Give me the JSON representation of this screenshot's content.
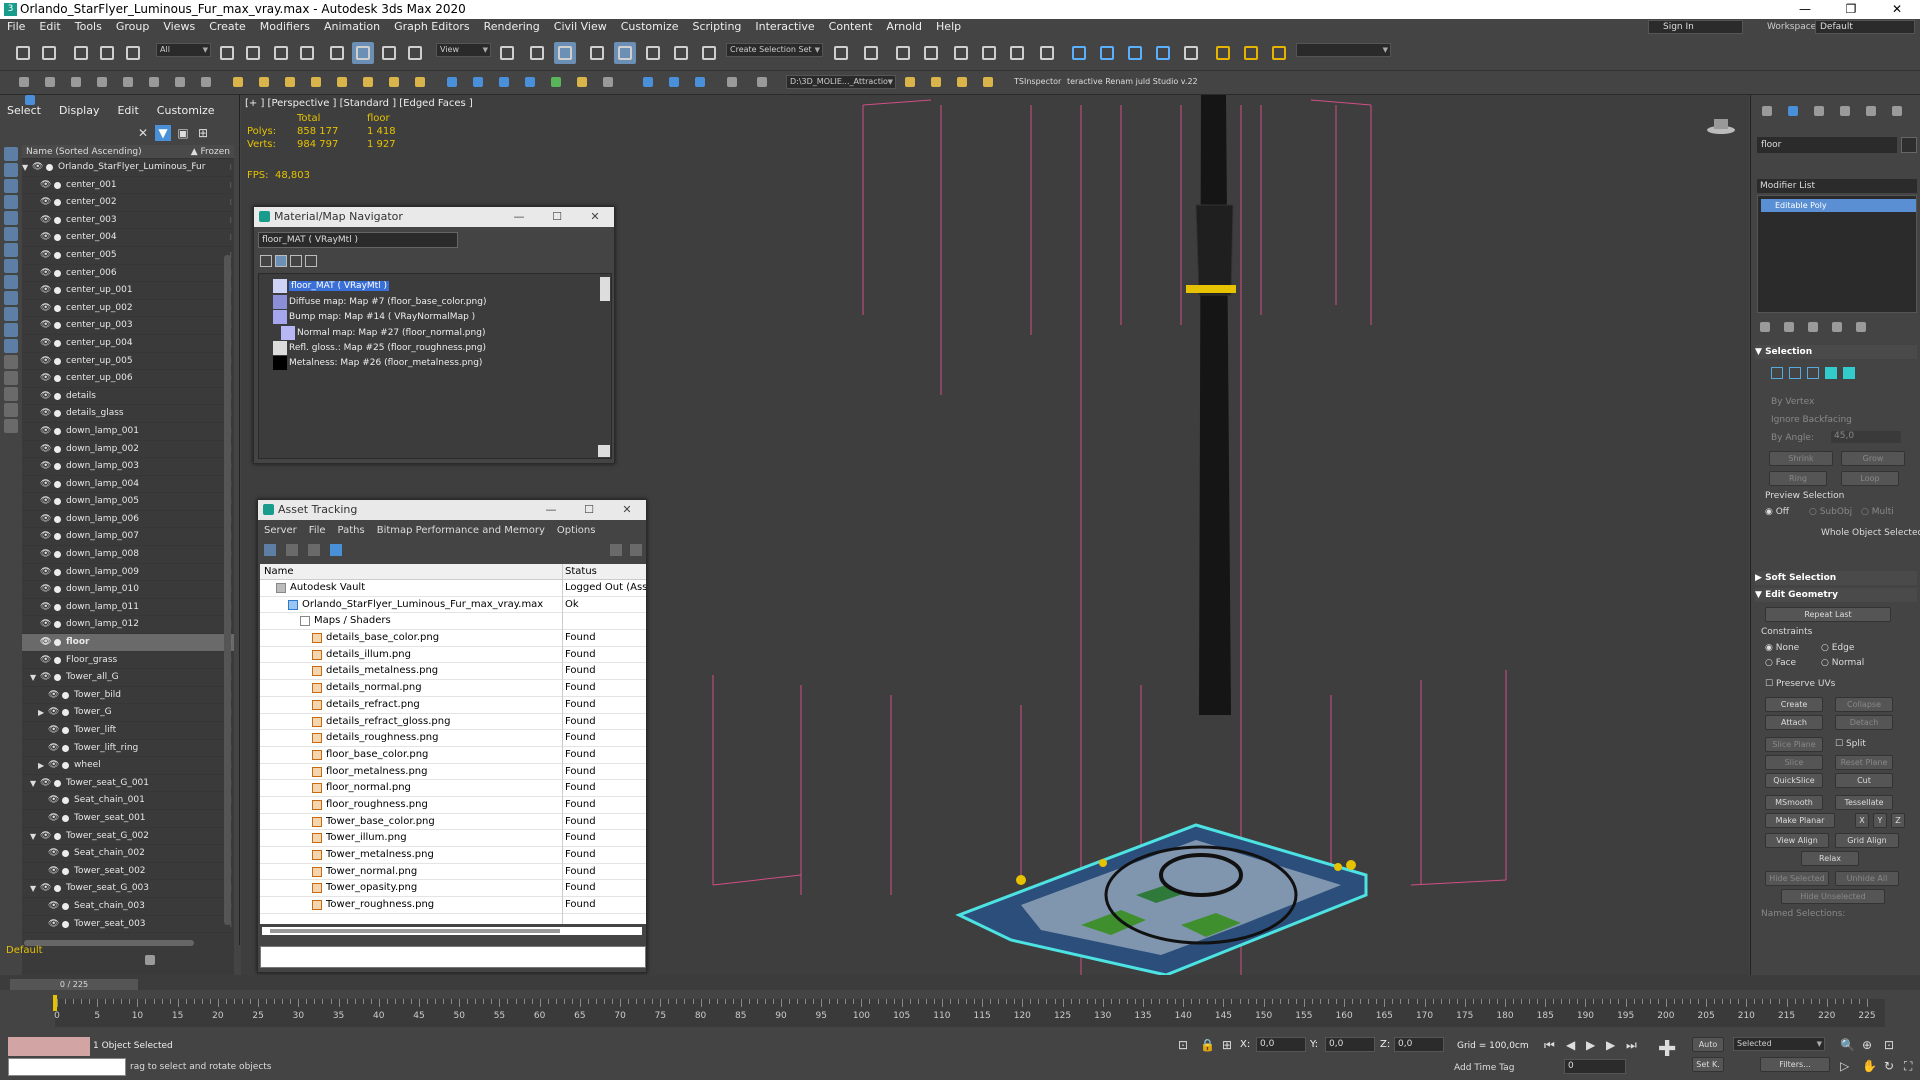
{
  "window": {
    "title": "Orlando_StarFlyer_Luminous_Fur_max_vray.max - Autodesk 3ds Max 2020",
    "icon": "3",
    "minimize": "—",
    "maximize": "❐",
    "close": "✕"
  },
  "menu": [
    "File",
    "Edit",
    "Tools",
    "Group",
    "Views",
    "Create",
    "Modifiers",
    "Animation",
    "Graph Editors",
    "Rendering",
    "Civil View",
    "Customize",
    "Scripting",
    "Interactive",
    "Content",
    "Arnold",
    "Help"
  ],
  "signin": "Sign In",
  "workspaces": {
    "label": "Workspaces:",
    "value": "Default"
  },
  "toolbar": {
    "filter": "All",
    "view": "View",
    "selection_set": "Create Selection Set",
    "path": "D:\\3D_MOLIE..._Attractio",
    "tsinspector": "TSInspector",
    "renamer": "teractive Renam juld Studio v.22"
  },
  "scene_explorer": {
    "menu": [
      "Select",
      "Display",
      "Edit",
      "Customize"
    ],
    "header": "Name (Sorted Ascending)",
    "frozen": "▲ Frozen",
    "layer": "Default",
    "items": [
      {
        "name": "Orlando_StarFlyer_Luminous_Fur",
        "level": 0,
        "tri": "▼",
        "icon": "obj"
      },
      {
        "name": "center_001",
        "level": 1
      },
      {
        "name": "center_002",
        "level": 1
      },
      {
        "name": "center_003",
        "level": 1
      },
      {
        "name": "center_004",
        "level": 1
      },
      {
        "name": "center_005",
        "level": 1
      },
      {
        "name": "center_006",
        "level": 1
      },
      {
        "name": "center_up_001",
        "level": 1
      },
      {
        "name": "center_up_002",
        "level": 1
      },
      {
        "name": "center_up_003",
        "level": 1
      },
      {
        "name": "center_up_004",
        "level": 1
      },
      {
        "name": "center_up_005",
        "level": 1
      },
      {
        "name": "center_up_006",
        "level": 1
      },
      {
        "name": "details",
        "level": 1
      },
      {
        "name": "details_glass",
        "level": 1
      },
      {
        "name": "down_lamp_001",
        "level": 1
      },
      {
        "name": "down_lamp_002",
        "level": 1
      },
      {
        "name": "down_lamp_003",
        "level": 1
      },
      {
        "name": "down_lamp_004",
        "level": 1
      },
      {
        "name": "down_lamp_005",
        "level": 1
      },
      {
        "name": "down_lamp_006",
        "level": 1
      },
      {
        "name": "down_lamp_007",
        "level": 1
      },
      {
        "name": "down_lamp_008",
        "level": 1
      },
      {
        "name": "down_lamp_009",
        "level": 1
      },
      {
        "name": "down_lamp_010",
        "level": 1
      },
      {
        "name": "down_lamp_011",
        "level": 1
      },
      {
        "name": "down_lamp_012",
        "level": 1
      },
      {
        "name": "floor",
        "level": 1,
        "selected": true
      },
      {
        "name": "Floor_grass",
        "level": 1
      },
      {
        "name": "Tower_all_G",
        "level": 1,
        "tri": "▼",
        "icon": "grp"
      },
      {
        "name": "Tower_bild",
        "level": 2
      },
      {
        "name": "Tower_G",
        "level": 2,
        "tri": "▶",
        "icon": "grp"
      },
      {
        "name": "Tower_lift",
        "level": 2
      },
      {
        "name": "Tower_lift_ring",
        "level": 2
      },
      {
        "name": "wheel",
        "level": 2,
        "tri": "▶"
      },
      {
        "name": "Tower_seat_G_001",
        "level": 1,
        "tri": "▼",
        "icon": "grp"
      },
      {
        "name": "Seat_chain_001",
        "level": 2
      },
      {
        "name": "Tower_seat_001",
        "level": 2
      },
      {
        "name": "Tower_seat_G_002",
        "level": 1,
        "tri": "▼",
        "icon": "grp"
      },
      {
        "name": "Seat_chain_002",
        "level": 2
      },
      {
        "name": "Tower_seat_002",
        "level": 2
      },
      {
        "name": "Tower_seat_G_003",
        "level": 1,
        "tri": "▼",
        "icon": "grp"
      },
      {
        "name": "Seat_chain_003",
        "level": 2
      },
      {
        "name": "Tower_seat_003",
        "level": 2
      }
    ]
  },
  "viewport": {
    "label": "[+ ] [Perspective ] [Standard ] [Edged Faces ]",
    "stats": {
      "h1": "Total",
      "h2": "floor",
      "polys_label": "Polys:",
      "polys_total": "858 177",
      "polys_sel": "1 418",
      "verts_label": "Verts:",
      "verts_total": "984 797",
      "verts_sel": "1 927"
    },
    "fps_label": "FPS:",
    "fps": "48,803"
  },
  "material_navigator": {
    "title": "Material/Map Navigator",
    "field": "floor_MAT  ( VRayMtl )",
    "root": "floor_MAT  ( VRayMtl )",
    "maps": [
      {
        "label": "Diffuse map: Map #7 (floor_base_color.png)",
        "swatch": "#8a8fd8"
      },
      {
        "label": "Bump map: Map #14  ( VRayNormalMap )",
        "swatch": "#a6a6ee"
      },
      {
        "label": "Normal map: Map #27 (floor_normal.png)",
        "swatch": "#b7b7f5"
      },
      {
        "label": "Refl. gloss.: Map #25 (floor_roughness.png)",
        "swatch": "#dcdcdc"
      },
      {
        "label": "Metalness: Map #26 (floor_metalness.png)",
        "swatch": "#000000"
      }
    ]
  },
  "asset_tracking": {
    "title": "Asset Tracking",
    "menu": [
      "Server",
      "File",
      "Paths",
      "Bitmap Performance and Memory",
      "Options"
    ],
    "col_name": "Name",
    "col_status": "Status",
    "rows": [
      {
        "name": "Autodesk Vault",
        "status": "Logged Out (Asset",
        "indent": 1,
        "icon": "v"
      },
      {
        "name": "Orlando_StarFlyer_Luminous_Fur_max_vray.max",
        "status": "Ok",
        "indent": 2,
        "icon": "m"
      },
      {
        "name": "Maps / Shaders",
        "status": "",
        "indent": 3,
        "icon": "f"
      },
      {
        "name": "details_base_color.png",
        "status": "Found",
        "indent": 4
      },
      {
        "name": "details_illum.png",
        "status": "Found",
        "indent": 4
      },
      {
        "name": "details_metalness.png",
        "status": "Found",
        "indent": 4
      },
      {
        "name": "details_normal.png",
        "status": "Found",
        "indent": 4
      },
      {
        "name": "details_refract.png",
        "status": "Found",
        "indent": 4
      },
      {
        "name": "details_refract_gloss.png",
        "status": "Found",
        "indent": 4
      },
      {
        "name": "details_roughness.png",
        "status": "Found",
        "indent": 4
      },
      {
        "name": "floor_base_color.png",
        "status": "Found",
        "indent": 4
      },
      {
        "name": "floor_metalness.png",
        "status": "Found",
        "indent": 4
      },
      {
        "name": "floor_normal.png",
        "status": "Found",
        "indent": 4
      },
      {
        "name": "floor_roughness.png",
        "status": "Found",
        "indent": 4
      },
      {
        "name": "Tower_base_color.png",
        "status": "Found",
        "indent": 4
      },
      {
        "name": "Tower_illum.png",
        "status": "Found",
        "indent": 4
      },
      {
        "name": "Tower_metalness.png",
        "status": "Found",
        "indent": 4
      },
      {
        "name": "Tower_normal.png",
        "status": "Found",
        "indent": 4
      },
      {
        "name": "Tower_opasity.png",
        "status": "Found",
        "indent": 4
      },
      {
        "name": "Tower_roughness.png",
        "status": "Found",
        "indent": 4
      }
    ]
  },
  "command_panel": {
    "object_name": "floor",
    "modifier_list": "Modifier List",
    "stack_item": "Editable Poly",
    "selection": {
      "title": "Selection",
      "by_vertex": "By Vertex",
      "ignore_backfacing": "Ignore Backfacing",
      "by_angle": "By Angle:",
      "angle": "45,0",
      "shrink": "Shrink",
      "grow": "Grow",
      "ring": "Ring",
      "loop": "Loop",
      "preview": "Preview Selection",
      "off": "Off",
      "subobj": "SubObj",
      "multi": "Multi",
      "whole": "Whole Object Selected"
    },
    "soft_selection": "Soft Selection",
    "edit_geometry": {
      "title": "Edit Geometry",
      "repeat_last": "Repeat Last",
      "constraints": "Constraints",
      "none": "None",
      "edge": "Edge",
      "face": "Face",
      "normal": "Normal",
      "preserve_uvs": "Preserve UVs",
      "create": "Create",
      "collapse": "Collapse",
      "attach": "Attach",
      "detach": "Detach",
      "slice_plane": "Slice Plane",
      "split": "Split",
      "slice": "Slice",
      "reset_plane": "Reset Plane",
      "quickslice": "QuickSlice",
      "cut": "Cut",
      "msmooth": "MSmooth",
      "tessellate": "Tessellate",
      "make_planar": "Make Planar",
      "x": "X",
      "y": "Y",
      "z": "Z",
      "view_align": "View Align",
      "grid_align": "Grid Align",
      "relax": "Relax",
      "hide_selected": "Hide Selected",
      "unhide_all": "Unhide All",
      "hide_unselected": "Hide Unselected",
      "named_selections": "Named Selections:"
    }
  },
  "timeline": {
    "slider": "0 / 225",
    "ticks": [
      0,
      5,
      10,
      15,
      20,
      25,
      30,
      35,
      40,
      45,
      50,
      55,
      60,
      65,
      70,
      75,
      80,
      85,
      90,
      95,
      100,
      105,
      110,
      115,
      120,
      125,
      130,
      135,
      140,
      145,
      150,
      155,
      160,
      165,
      170,
      175,
      180,
      185,
      190,
      195,
      200,
      205,
      210,
      215,
      220,
      225
    ]
  },
  "status": {
    "objects": "1 Object Selected",
    "hint": "rag to select and rotate objects",
    "x_label": "X:",
    "x": "0,0",
    "y_label": "Y:",
    "y": "0,0",
    "z_label": "Z:",
    "z": "0,0",
    "grid": "Grid = 100,0cm",
    "add_time_tag": "Add Time Tag",
    "auto": "Auto",
    "selected": "Selected",
    "setk": "Set K.",
    "filters": "Filters...",
    "frame": "0"
  }
}
